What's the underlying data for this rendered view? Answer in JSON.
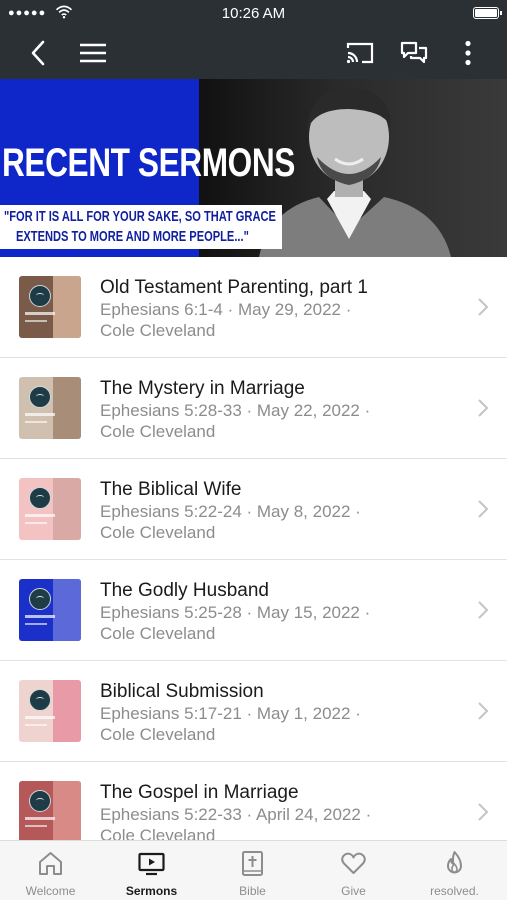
{
  "status_bar": {
    "signal": "●●●●●",
    "time": "10:26 AM"
  },
  "banner": {
    "title": "RECENT SERMONS",
    "quote_line1": "\"FOR IT IS ALL FOR YOUR SAKE, SO THAT GRACE",
    "quote_line2": "EXTENDS TO MORE AND MORE PEOPLE...\""
  },
  "colors": {
    "nav_bg": "#2b3035",
    "banner_blue": "#0f26c9",
    "quote_text": "#0f1f9e",
    "subtitle_gray": "#8c8c8c"
  },
  "sermons": [
    {
      "title": "Old Testament Parenting, part 1",
      "meta": "Ephesians 6:1-4 · May 29, 2022 ·",
      "speaker": "Cole Cleveland",
      "thumb_bg": "#7a5a48",
      "thumb_stripe": "#c8a58c"
    },
    {
      "title": "The Mystery in Marriage",
      "meta": "Ephesians 5:28-33 · May 22, 2022 ·",
      "speaker": "Cole Cleveland",
      "thumb_bg": "#cfc0b0",
      "thumb_stripe": "#a88e78"
    },
    {
      "title": "The Biblical Wife",
      "meta": "Ephesians 5:22-24 · May 8, 2022 ·",
      "speaker": "Cole Cleveland",
      "thumb_bg": "#f3c3c4",
      "thumb_stripe": "#d9a9a6"
    },
    {
      "title": "The Godly Husband",
      "meta": "Ephesians 5:25-28 · May 15, 2022 ·",
      "speaker": "Cole Cleveland",
      "thumb_bg": "#1b2fc9",
      "thumb_stripe": "#5b6ad8"
    },
    {
      "title": "Biblical Submission",
      "meta": "Ephesians 5:17-21 · May 1, 2022 ·",
      "speaker": "Cole Cleveland",
      "thumb_bg": "#efd3ce",
      "thumb_stripe": "#e89aa6"
    },
    {
      "title": "The Gospel in Marriage",
      "meta": "Ephesians 5:22-33 · April 24, 2022 ·",
      "speaker": "Cole Cleveland",
      "thumb_bg": "#b4585a",
      "thumb_stripe": "#d88a86"
    }
  ],
  "tabs": [
    {
      "label": "Welcome",
      "icon": "home-icon"
    },
    {
      "label": "Sermons",
      "icon": "tv-play-icon",
      "active": true
    },
    {
      "label": "Bible",
      "icon": "bible-icon"
    },
    {
      "label": "Give",
      "icon": "heart-icon"
    },
    {
      "label": "resolved.",
      "icon": "flame-icon"
    }
  ]
}
